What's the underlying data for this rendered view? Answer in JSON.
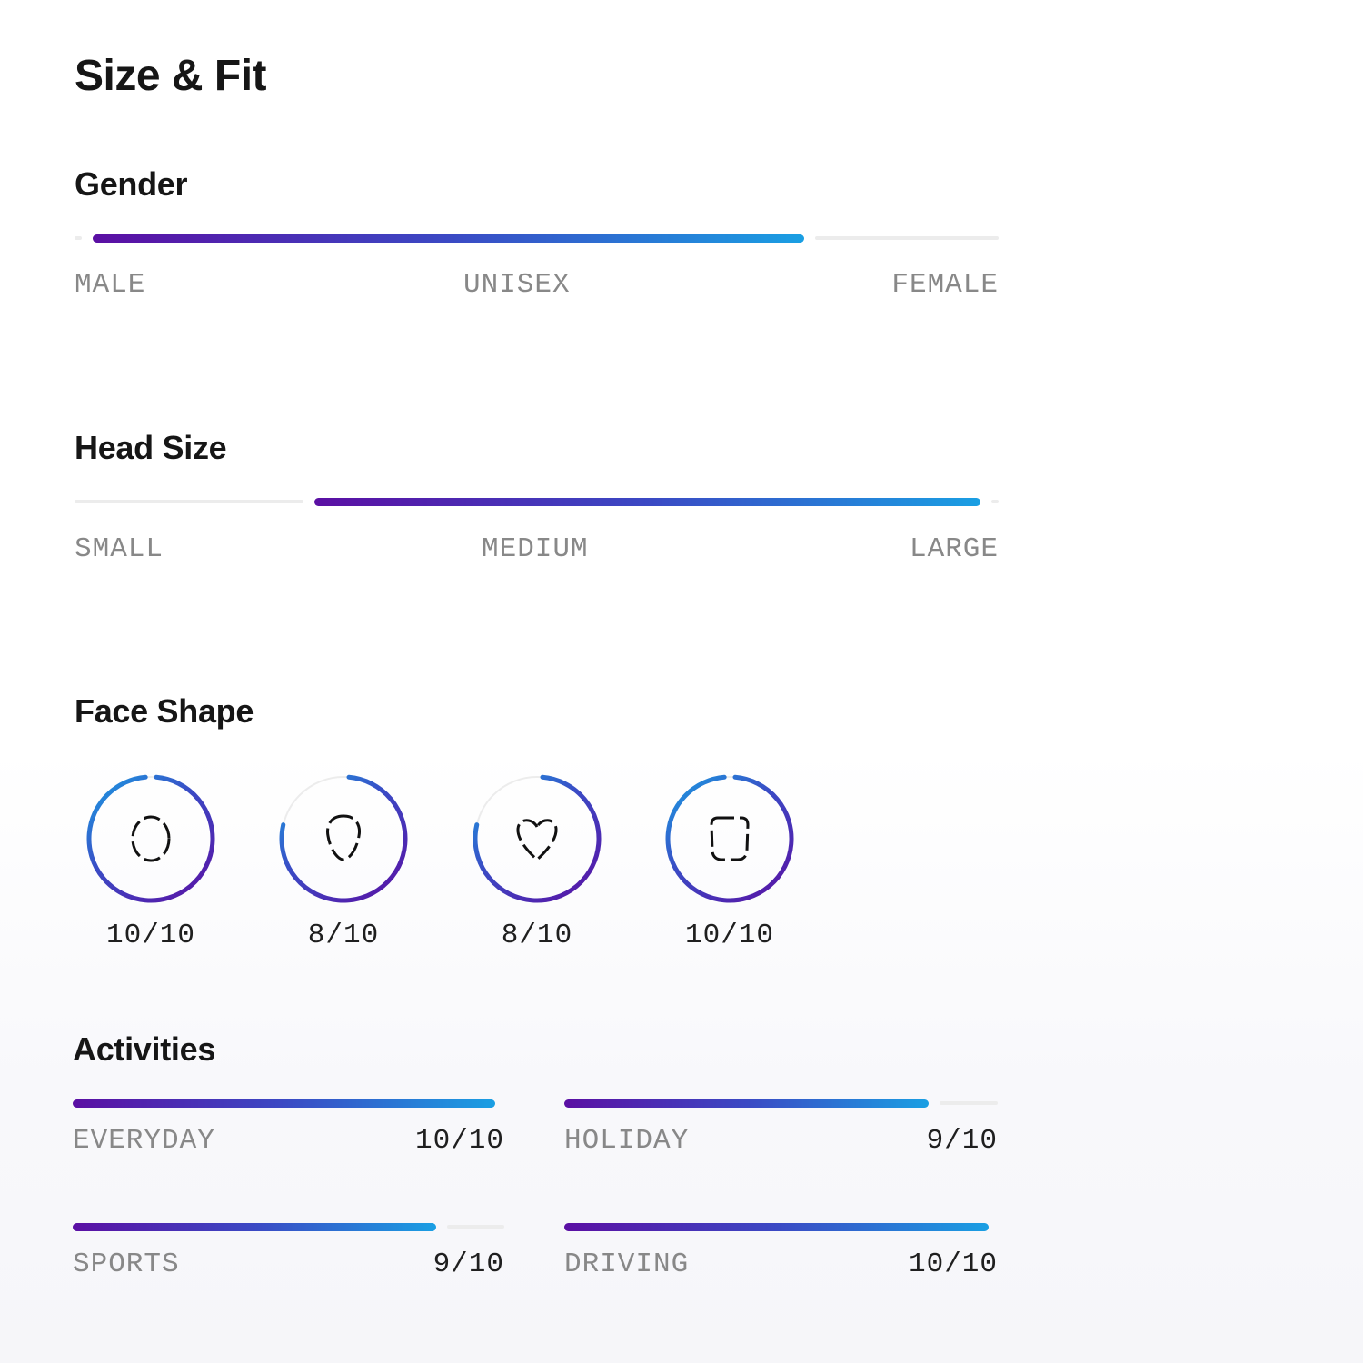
{
  "title": "Size & Fit",
  "colors": {
    "gradient_start": "#5b0fa3",
    "gradient_mid": "#3b49c4",
    "gradient_end": "#1a9fe3",
    "track": "#ececec"
  },
  "gender": {
    "title": "Gender",
    "labels": [
      "MALE",
      "UNISEX",
      "FEMALE"
    ],
    "range_start": 0.02,
    "range_end": 0.79
  },
  "head_size": {
    "title": "Head Size",
    "labels": [
      "SMALL",
      "MEDIUM",
      "LARGE"
    ],
    "range_start": 0.26,
    "range_end": 0.98
  },
  "face_shape": {
    "title": "Face Shape",
    "items": [
      {
        "icon": "round-face-icon",
        "score": "10/10",
        "value": 10
      },
      {
        "icon": "oval-face-icon",
        "score": "8/10",
        "value": 8
      },
      {
        "icon": "heart-face-icon",
        "score": "8/10",
        "value": 8
      },
      {
        "icon": "square-face-icon",
        "score": "10/10",
        "value": 10
      }
    ]
  },
  "activities": {
    "title": "Activities",
    "items": [
      {
        "label": "EVERYDAY",
        "score": "10/10",
        "value": 10
      },
      {
        "label": "HOLIDAY",
        "score": "9/10",
        "value": 9
      },
      {
        "label": "SPORTS",
        "score": "9/10",
        "value": 9
      },
      {
        "label": "DRIVING",
        "score": "10/10",
        "value": 10
      }
    ]
  }
}
